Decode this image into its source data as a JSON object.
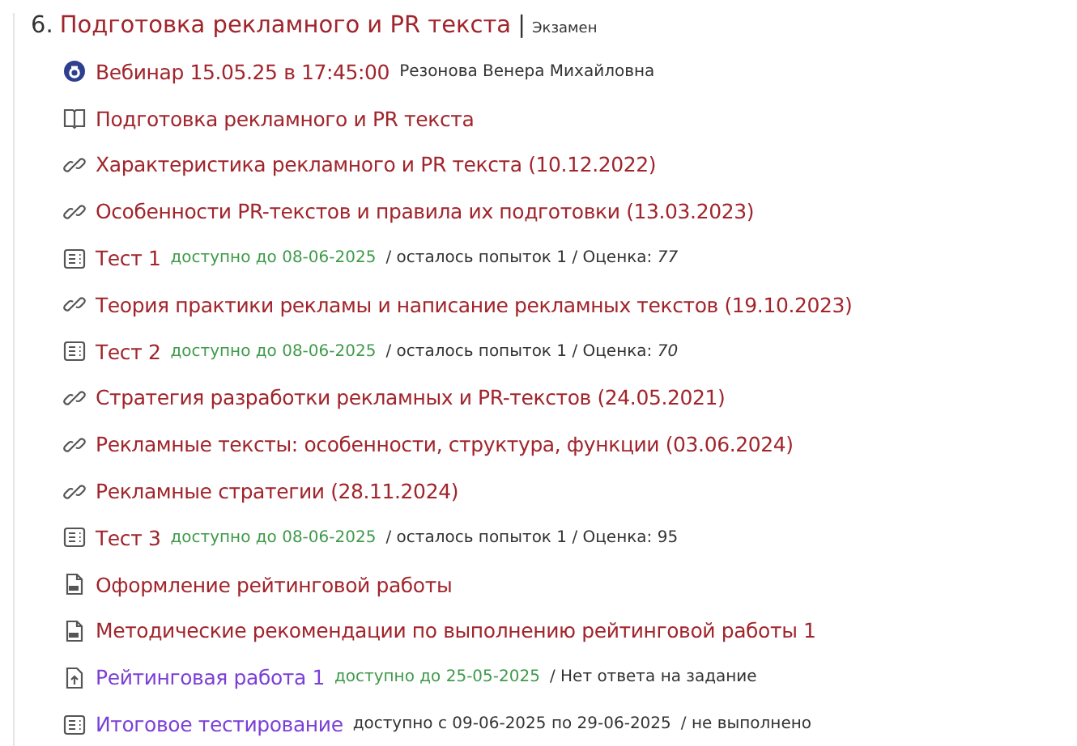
{
  "section": {
    "number": "6.",
    "title": "Подготовка рекламного и PR текста",
    "separator": "|",
    "tag": "Экзамен"
  },
  "items": [
    {
      "kind": "webinar",
      "title": "Вебинар 15.05.25 в 17:45:00",
      "color": "#a1252c",
      "note": "Резонова Венера Михайловна"
    },
    {
      "kind": "book",
      "title": "Подготовка рекламного и PR текста",
      "color": "#a1252c"
    },
    {
      "kind": "link",
      "title": "Характеристика рекламного и PR текста (10.12.2022)",
      "color": "#a1252c"
    },
    {
      "kind": "link",
      "title": "Особенности PR-текстов и правила их подготовки (13.03.2023)",
      "color": "#a1252c"
    },
    {
      "kind": "test",
      "title": "Тест 1",
      "color": "#a1252c",
      "availability": "доступно до 08-06-2025",
      "open": true,
      "note": "/ осталось попыток 1 / Оценка: *77*"
    },
    {
      "kind": "link",
      "title": "Теория практики рекламы и написание рекламных текстов (19.10.2023)",
      "color": "#a1252c"
    },
    {
      "kind": "test",
      "title": "Тест 2",
      "color": "#a1252c",
      "availability": "доступно до 08-06-2025",
      "open": true,
      "note": "/ осталось попыток 1 / Оценка: *70*"
    },
    {
      "kind": "link",
      "title": "Стратегия разработки рекламных и PR-текстов (24.05.2021)",
      "color": "#a1252c"
    },
    {
      "kind": "link",
      "title": "Рекламные тексты: особенности, структура, функции (03.06.2024)",
      "color": "#a1252c"
    },
    {
      "kind": "link",
      "title": "Рекламные стратегии (28.11.2024)",
      "color": "#a1252c"
    },
    {
      "kind": "test",
      "title": "Тест 3",
      "color": "#a1252c",
      "availability": "доступно до 08-06-2025",
      "open": true,
      "note": "/ осталось попыток 1 / Оценка: 95"
    },
    {
      "kind": "doc",
      "title": "Оформление рейтинговой работы",
      "color": "#a1252c"
    },
    {
      "kind": "doc",
      "title": "Методические рекомендации по выполнению рейтинговой работы 1",
      "color": "#a1252c"
    },
    {
      "kind": "upload",
      "title": "Рейтинговая работа 1",
      "color": "#7b3fd6",
      "availability": "доступно до 25-05-2025",
      "open": true,
      "note": "/ Нет ответа на задание"
    },
    {
      "kind": "test",
      "title": "Итоговое тестирование",
      "color": "#7b3fd6",
      "availability": "доступно с 09-06-2025 по 29-06-2025",
      "open": false,
      "note": "/ не выполнено"
    }
  ]
}
